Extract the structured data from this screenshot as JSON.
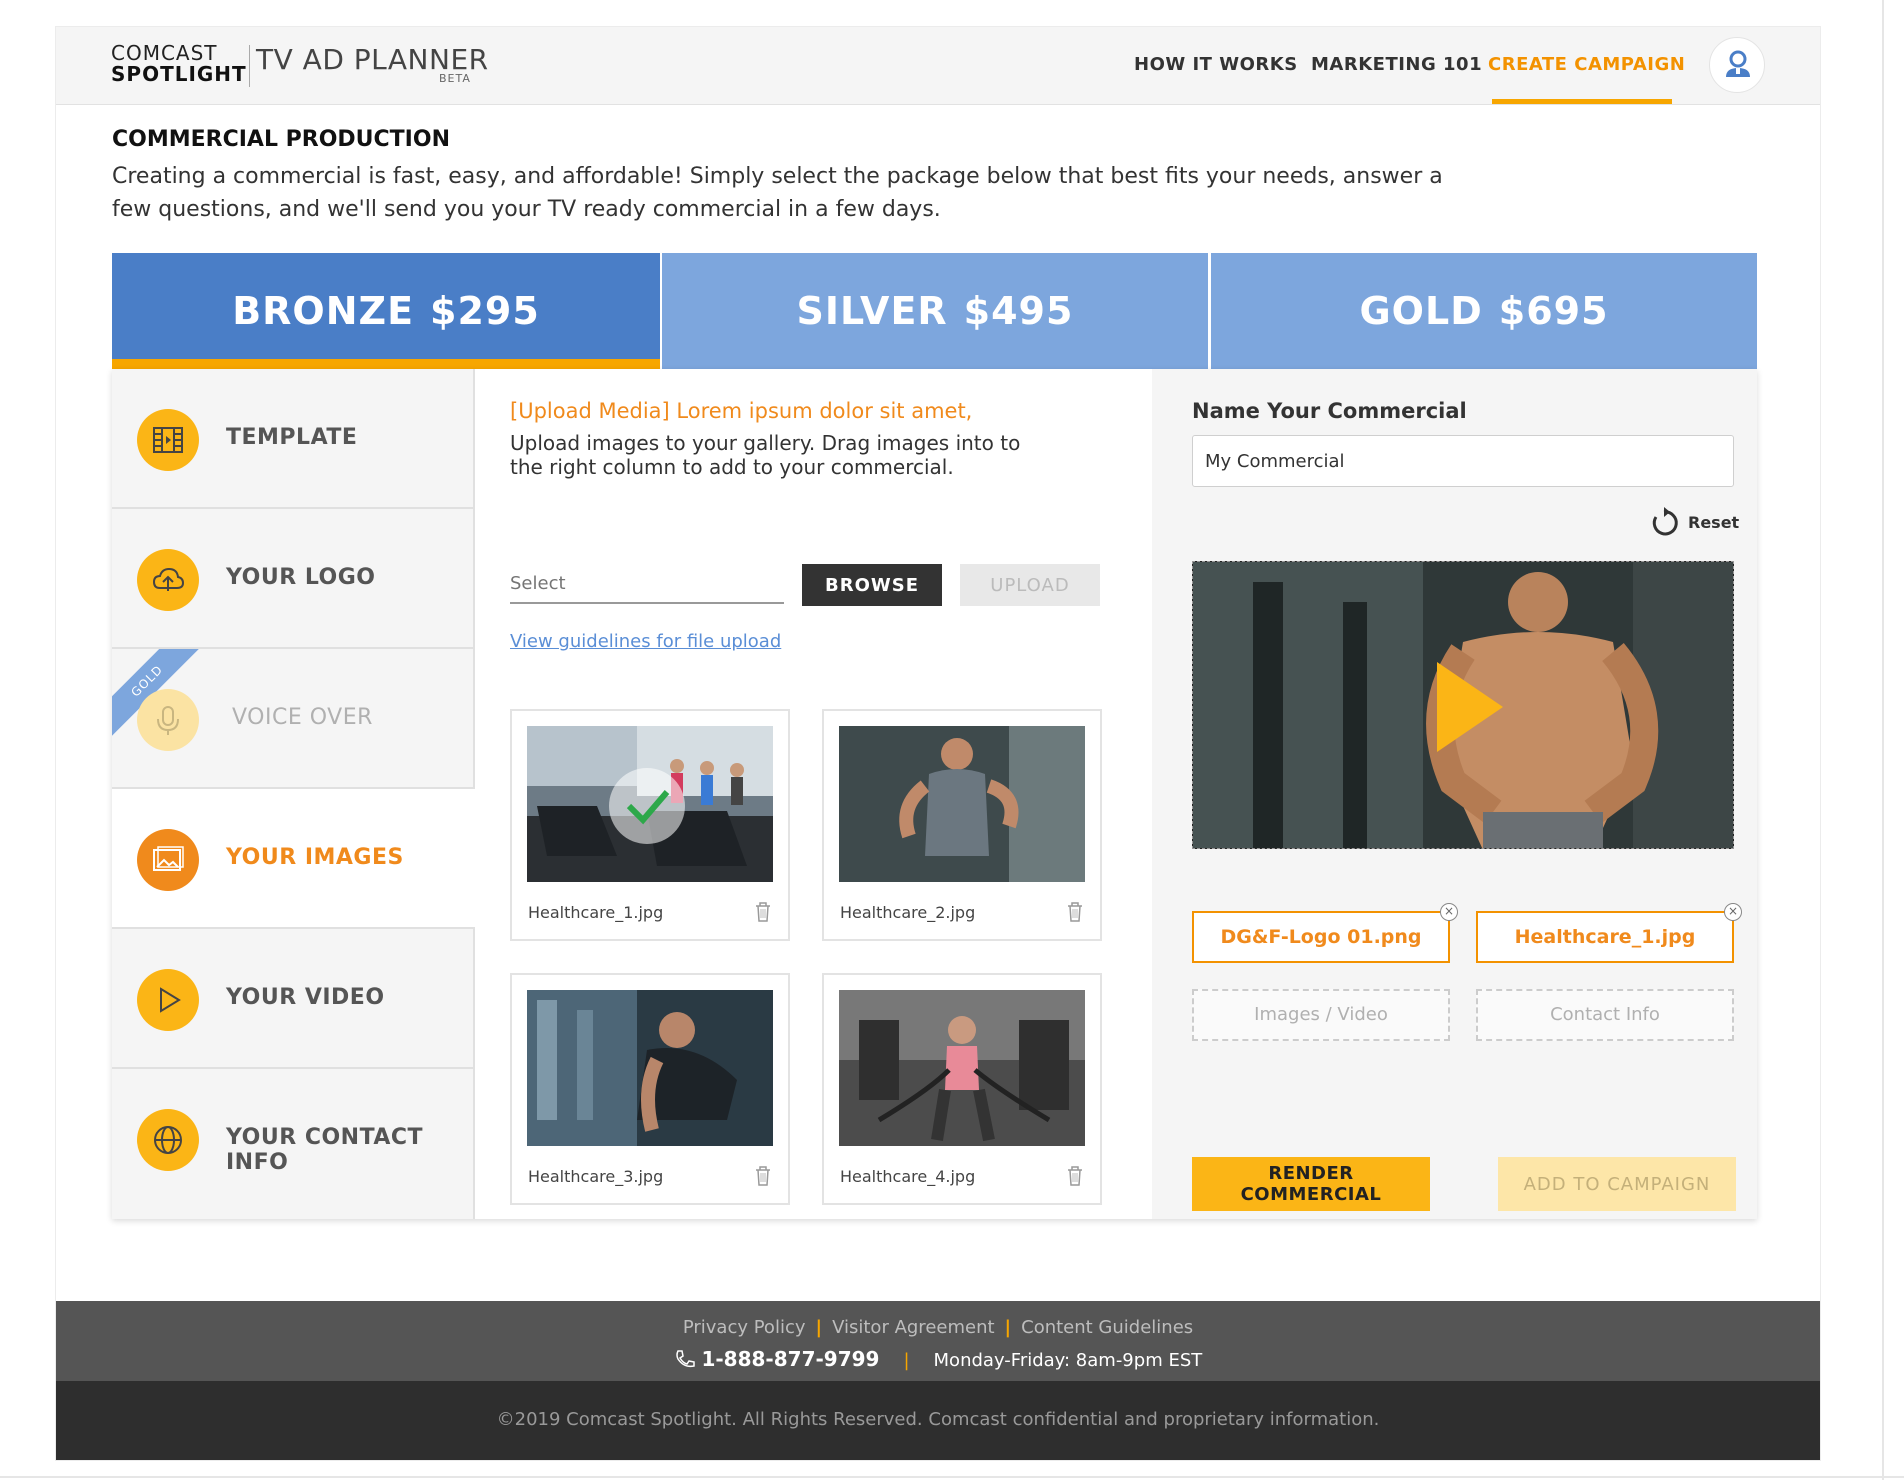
{
  "header": {
    "brand_line1": "COMCAST",
    "brand_line2": "SPOTLIGHT",
    "product": "TV AD PLANNER",
    "beta": "BETA",
    "nav": [
      "HOW IT WORKS",
      "MARKETING 101",
      "CREATE CAMPAIGN"
    ],
    "active_nav": "CREATE CAMPAIGN"
  },
  "intro": {
    "title": "COMMERCIAL PRODUCTION",
    "description": "Creating a commercial is fast, easy, and affordable! Simply select the package below that best fits your needs, answer a few questions, and we'll send you your TV ready commercial in a few days."
  },
  "packages": [
    {
      "name": "BRONZE",
      "price": "$295",
      "selected": true
    },
    {
      "name": "SILVER",
      "price": "$495",
      "selected": false
    },
    {
      "name": "GOLD",
      "price": "$695",
      "selected": false
    }
  ],
  "steps": [
    {
      "label": "TEMPLATE",
      "icon": "film-icon"
    },
    {
      "label": "YOUR LOGO",
      "icon": "cloud-upload-icon"
    },
    {
      "label": "VOICE OVER",
      "icon": "microphone-icon",
      "badge": "GOLD",
      "disabled": true
    },
    {
      "label": "YOUR IMAGES",
      "icon": "images-icon",
      "active": true
    },
    {
      "label": "YOUR VIDEO",
      "icon": "play-icon"
    },
    {
      "label": "YOUR CONTACT INFO",
      "icon": "globe-icon"
    }
  ],
  "upload": {
    "heading": "[Upload Media] Lorem ipsum dolor sit amet,",
    "description": "Upload images to your gallery. Drag images into to the right column to add to your commercial.",
    "select_placeholder": "Select",
    "browse_label": "BROWSE",
    "upload_label": "UPLOAD",
    "guidelines_link": "View guidelines for file upload",
    "gallery": [
      {
        "file": "Healthcare_1.jpg",
        "selected": true
      },
      {
        "file": "Healthcare_2.jpg",
        "selected": false
      },
      {
        "file": "Healthcare_3.jpg",
        "selected": false
      },
      {
        "file": "Healthcare_4.jpg",
        "selected": false
      }
    ]
  },
  "commercial": {
    "name_label": "Name Your Commercial",
    "name_value": "My Commercial",
    "reset_label": "Reset",
    "chips": [
      "DG&F-Logo 01.png",
      "Healthcare_1.jpg"
    ],
    "slots": [
      "Images / Video",
      "Contact Info"
    ],
    "render_label": "RENDER COMMERCIAL",
    "add_label": "ADD TO CAMPAIGN"
  },
  "footer": {
    "links": [
      "Privacy Policy",
      "Visitor Agreement",
      "Content Guidelines"
    ],
    "phone": "1-888-877-9799",
    "hours": "Monday-Friday: 8am-9pm EST",
    "copyright": "©2019 Comcast Spotlight. All Rights Reserved. Comcast confidential and proprietary information."
  },
  "colors": {
    "accent_orange": "#f39200",
    "accent_yellow": "#fbb516",
    "tab_blue": "#4a7ec7",
    "tab_light_blue": "#7da6dd"
  }
}
